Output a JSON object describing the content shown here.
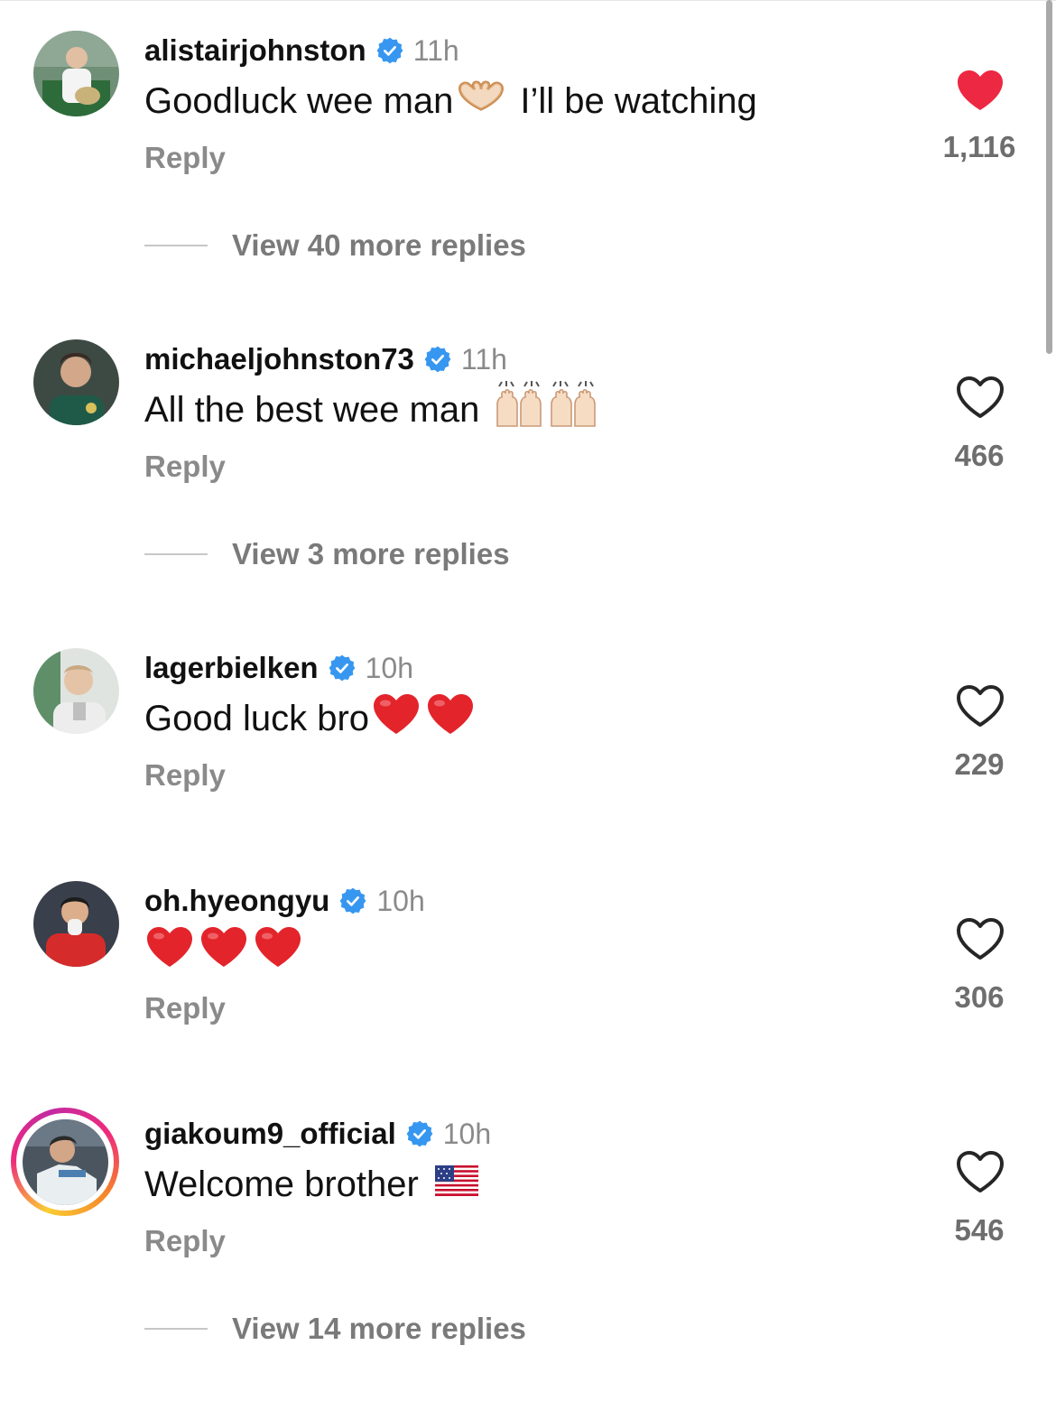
{
  "comments": [
    {
      "username": "alistairjohnston",
      "verified": true,
      "time": "11h",
      "text": "Goodluck wee man",
      "text_suffix": "I’ll be watching",
      "emojis": [
        "heart-hands-emoji"
      ],
      "reply_label": "Reply",
      "liked": true,
      "like_count": "1,116",
      "view_more": "View 40 more replies"
    },
    {
      "username": "michaeljohnston73",
      "verified": true,
      "time": "11h",
      "text": "All the best wee man",
      "emojis": [
        "raising-hands-emoji",
        "raising-hands-emoji"
      ],
      "reply_label": "Reply",
      "liked": false,
      "like_count": "466",
      "view_more": "View 3 more replies"
    },
    {
      "username": "lagerbielken",
      "verified": true,
      "time": "10h",
      "text": "Good luck bro",
      "emojis": [
        "red-heart-emoji",
        "red-heart-emoji"
      ],
      "reply_label": "Reply",
      "liked": false,
      "like_count": "229"
    },
    {
      "username": "oh.hyeongyu",
      "verified": true,
      "time": "10h",
      "text": "",
      "emojis": [
        "red-heart-emoji",
        "red-heart-emoji",
        "red-heart-emoji"
      ],
      "reply_label": "Reply",
      "liked": false,
      "like_count": "306"
    },
    {
      "username": "giakoum9_official",
      "verified": true,
      "has_story_ring": true,
      "time": "10h",
      "text": "Welcome brother",
      "emojis": [
        "us-flag-emoji"
      ],
      "reply_label": "Reply",
      "liked": false,
      "like_count": "546",
      "view_more": "View 14 more replies"
    }
  ],
  "colors": {
    "liked_heart": "#ed2842",
    "verified_badge": "#3797f0",
    "secondary_text": "#8a8a8a",
    "story_ring": [
      "#f9ce34",
      "#ee2a7b",
      "#c32aa3"
    ]
  }
}
